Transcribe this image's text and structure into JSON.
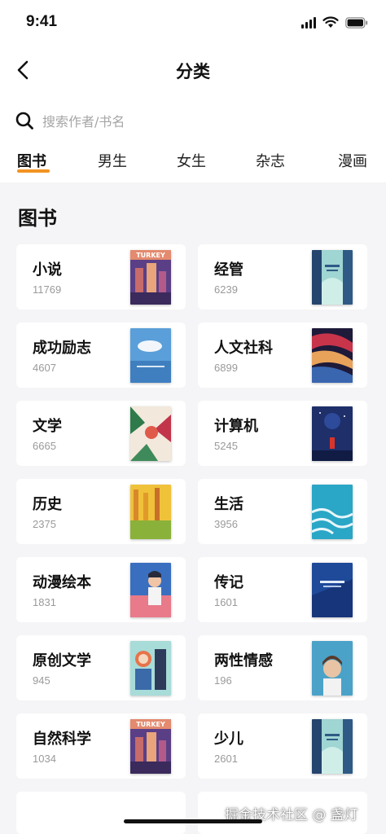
{
  "status_bar": {
    "time": "9:41"
  },
  "nav": {
    "title": "分类"
  },
  "search": {
    "placeholder": "搜索作者/书名"
  },
  "tabs": [
    {
      "label": "图书",
      "active": true
    },
    {
      "label": "男生",
      "active": false
    },
    {
      "label": "女生",
      "active": false
    },
    {
      "label": "杂志",
      "active": false
    },
    {
      "label": "漫画",
      "active": false
    }
  ],
  "section": {
    "title": "图书"
  },
  "categories": [
    {
      "name": "小说",
      "count": "11769",
      "cover": "turkey"
    },
    {
      "name": "经管",
      "count": "6239",
      "cover": "forest"
    },
    {
      "name": "成功励志",
      "count": "4607",
      "cover": "cloud"
    },
    {
      "name": "人文社科",
      "count": "6899",
      "cover": "abstract"
    },
    {
      "name": "文学",
      "count": "6665",
      "cover": "jungle"
    },
    {
      "name": "计算机",
      "count": "5245",
      "cover": "night"
    },
    {
      "name": "历史",
      "count": "2375",
      "cover": "wolf"
    },
    {
      "name": "生活",
      "count": "3956",
      "cover": "waves"
    },
    {
      "name": "动漫绘本",
      "count": "1831",
      "cover": "boy"
    },
    {
      "name": "传记",
      "count": "1601",
      "cover": "moon"
    },
    {
      "name": "原创文学",
      "count": "945",
      "cover": "girl"
    },
    {
      "name": "两性情感",
      "count": "196",
      "cover": "portrait"
    },
    {
      "name": "自然科学",
      "count": "1034",
      "cover": "turkey"
    },
    {
      "name": "少儿",
      "count": "2601",
      "cover": "forest"
    }
  ],
  "watermark": "掘金技术社区 @ 盏灯",
  "colors": {
    "accent": "#f39422",
    "background": "#f5f5f7"
  }
}
